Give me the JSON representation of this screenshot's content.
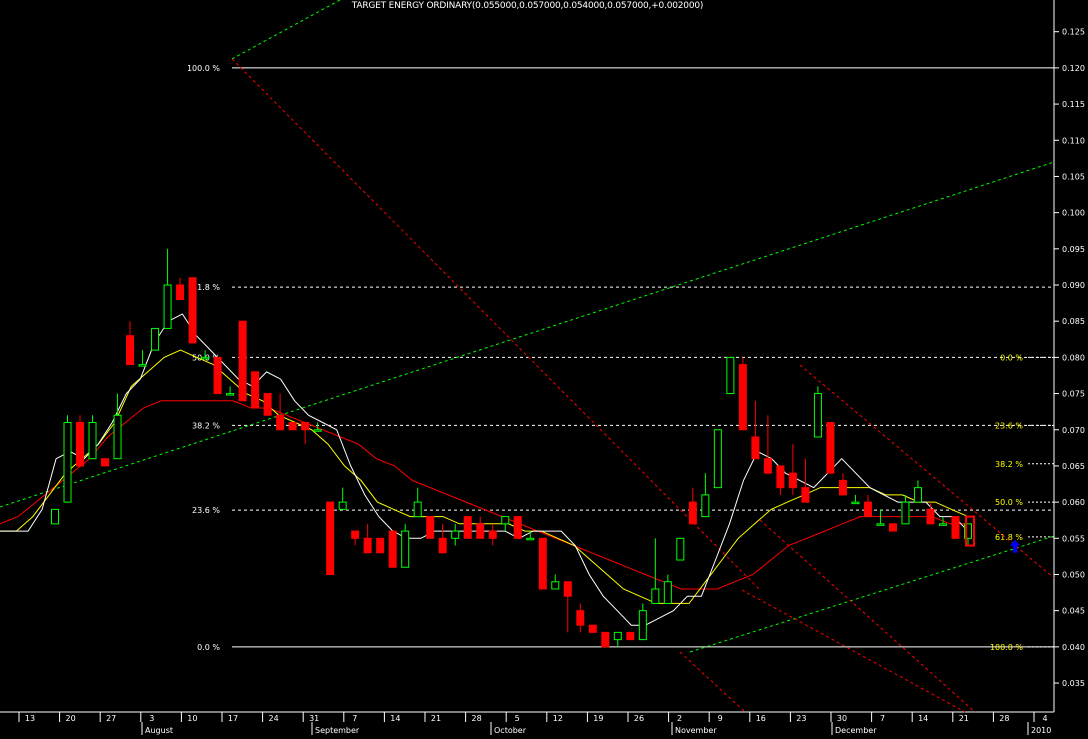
{
  "chart_data": {
    "type": "candlestick",
    "title": "TARGET ENERGY ORDINARY(0.055000,0.057000,0.054000,0.057000,+0.002000)",
    "colors": {
      "background": "#000000",
      "up_candle": "#00ff00",
      "down_candle": "#ff0000",
      "ma_fast": "#ffffff",
      "ma_mid": "#ffff00",
      "ma_slow": "#ff0000",
      "trendline": "#00ff00",
      "fan_line": "#ff0000",
      "fib_level": "#ffffff",
      "fib_label_right": "#ffff00",
      "arrow": "#0000ff"
    },
    "y_axis": {
      "range": [
        0.031,
        0.128
      ],
      "ticks": [
        "0.035",
        "0.040",
        "0.045",
        "0.050",
        "0.055",
        "0.060",
        "0.065",
        "0.070",
        "0.075",
        "0.080",
        "0.085",
        "0.090",
        "0.095",
        "0.100",
        "0.105",
        "0.110",
        "0.115",
        "0.120",
        "0.125"
      ]
    },
    "x_axis": {
      "day_ticks": [
        "13",
        "20",
        "27",
        "3",
        "10",
        "17",
        "24",
        "31",
        "7",
        "14",
        "21",
        "28",
        "5",
        "12",
        "19",
        "26",
        "2",
        "9",
        "16",
        "23",
        "30",
        "7",
        "14",
        "21",
        "28",
        "4"
      ],
      "months": [
        "August",
        "September",
        "October",
        "November",
        "December",
        "2010"
      ]
    },
    "fib_retracement_left": [
      {
        "label": "100.0 %",
        "value": 0.12
      },
      {
        "label": "61.8 %",
        "value": 0.0897
      },
      {
        "label": "50.0 %",
        "value": 0.08
      },
      {
        "label": "38.2 %",
        "value": 0.0706
      },
      {
        "label": "23.6 %",
        "value": 0.0589
      },
      {
        "label": "0.0 %",
        "value": 0.04
      }
    ],
    "fib_retracement_right": [
      {
        "label": "0.0 %",
        "value": 0.08
      },
      {
        "label": "23.6 %",
        "value": 0.0706
      },
      {
        "label": "38.2 %",
        "value": 0.0653
      },
      {
        "label": "50.0 %",
        "value": 0.06
      },
      {
        "label": "61.8 %",
        "value": 0.0552
      },
      {
        "label": "100.0 %",
        "value": 0.04
      }
    ],
    "candles": [
      [
        0.057,
        0.059,
        0.057,
        0.059
      ],
      [
        0.06,
        0.072,
        0.06,
        0.071
      ],
      [
        0.071,
        0.072,
        0.065,
        0.065
      ],
      [
        0.066,
        0.072,
        0.066,
        0.071
      ],
      [
        0.066,
        0.066,
        0.065,
        0.065
      ],
      [
        0.066,
        0.075,
        0.066,
        0.072
      ],
      [
        0.083,
        0.085,
        0.079,
        0.079
      ],
      [
        0.079,
        0.081,
        0.079,
        0.079
      ],
      [
        0.081,
        0.084,
        0.081,
        0.084
      ],
      [
        0.084,
        0.095,
        0.084,
        0.09
      ],
      [
        0.09,
        0.091,
        0.088,
        0.088
      ],
      [
        0.091,
        0.091,
        0.082,
        0.082
      ],
      [
        0.08,
        0.081,
        0.08,
        0.08
      ],
      [
        0.08,
        0.08,
        0.075,
        0.075
      ],
      [
        0.075,
        0.076,
        0.075,
        0.075
      ],
      [
        0.085,
        0.085,
        0.074,
        0.074
      ],
      [
        0.078,
        0.078,
        0.073,
        0.073
      ],
      [
        0.075,
        0.075,
        0.072,
        0.072
      ],
      [
        0.072,
        0.075,
        0.07,
        0.07
      ],
      [
        0.071,
        0.071,
        0.07,
        0.07
      ],
      [
        0.071,
        0.071,
        0.068,
        0.07
      ],
      [
        0.07,
        0.071,
        0.07,
        0.07
      ],
      [
        0.06,
        0.06,
        0.05,
        0.05
      ],
      [
        0.059,
        0.062,
        0.059,
        0.06
      ],
      [
        0.056,
        0.056,
        0.054,
        0.055
      ],
      [
        0.055,
        0.057,
        0.053,
        0.053
      ],
      [
        0.055,
        0.055,
        0.053,
        0.053
      ],
      [
        0.056,
        0.056,
        0.051,
        0.051
      ],
      [
        0.051,
        0.057,
        0.051,
        0.056
      ],
      [
        0.058,
        0.062,
        0.058,
        0.06
      ],
      [
        0.058,
        0.058,
        0.055,
        0.055
      ],
      [
        0.055,
        0.057,
        0.053,
        0.053
      ],
      [
        0.055,
        0.057,
        0.054,
        0.056
      ],
      [
        0.058,
        0.058,
        0.055,
        0.055
      ],
      [
        0.057,
        0.058,
        0.055,
        0.055
      ],
      [
        0.056,
        0.057,
        0.054,
        0.055
      ],
      [
        0.057,
        0.058,
        0.056,
        0.058
      ],
      [
        0.058,
        0.058,
        0.055,
        0.055
      ],
      [
        0.055,
        0.056,
        0.055,
        0.055
      ],
      [
        0.055,
        0.055,
        0.048,
        0.048
      ],
      [
        0.048,
        0.05,
        0.048,
        0.049
      ],
      [
        0.049,
        0.049,
        0.042,
        0.047
      ],
      [
        0.045,
        0.046,
        0.042,
        0.043
      ],
      [
        0.043,
        0.043,
        0.042,
        0.042
      ],
      [
        0.042,
        0.042,
        0.04,
        0.04
      ],
      [
        0.041,
        0.042,
        0.04,
        0.042
      ],
      [
        0.042,
        0.042,
        0.041,
        0.041
      ],
      [
        0.041,
        0.046,
        0.041,
        0.045
      ],
      [
        0.046,
        0.055,
        0.046,
        0.048
      ],
      [
        0.046,
        0.05,
        0.046,
        0.049
      ],
      [
        0.052,
        0.055,
        0.052,
        0.055
      ],
      [
        0.06,
        0.062,
        0.057,
        0.057
      ],
      [
        0.058,
        0.064,
        0.058,
        0.061
      ],
      [
        0.062,
        0.07,
        0.062,
        0.07
      ],
      [
        0.075,
        0.08,
        0.075,
        0.08
      ],
      [
        0.079,
        0.08,
        0.07,
        0.07
      ],
      [
        0.069,
        0.074,
        0.066,
        0.066
      ],
      [
        0.066,
        0.072,
        0.064,
        0.064
      ],
      [
        0.065,
        0.065,
        0.061,
        0.062
      ],
      [
        0.064,
        0.068,
        0.061,
        0.062
      ],
      [
        0.062,
        0.066,
        0.06,
        0.06
      ],
      [
        0.069,
        0.076,
        0.069,
        0.075
      ],
      [
        0.071,
        0.071,
        0.064,
        0.064
      ],
      [
        0.063,
        0.064,
        0.061,
        0.061
      ],
      [
        0.06,
        0.061,
        0.06,
        0.06
      ],
      [
        0.06,
        0.061,
        0.058,
        0.058
      ],
      [
        0.057,
        0.059,
        0.057,
        0.057
      ],
      [
        0.057,
        0.057,
        0.056,
        0.056
      ],
      [
        0.057,
        0.061,
        0.057,
        0.06
      ],
      [
        0.06,
        0.063,
        0.06,
        0.062
      ],
      [
        0.059,
        0.06,
        0.057,
        0.057
      ],
      [
        0.057,
        0.058,
        0.057,
        0.057
      ],
      [
        0.058,
        0.058,
        0.055,
        0.055
      ],
      [
        0.055,
        0.057,
        0.054,
        0.057
      ]
    ],
    "ma_fast": [
      0.056,
      0.056,
      0.056,
      0.059,
      0.066,
      0.067,
      0.066,
      0.068,
      0.071,
      0.075,
      0.077,
      0.082,
      0.085,
      0.086,
      0.083,
      0.081,
      0.079,
      0.077,
      0.076,
      0.078,
      0.077,
      0.074,
      0.072,
      0.071,
      0.07,
      0.065,
      0.061,
      0.058,
      0.056,
      0.055,
      0.055,
      0.056,
      0.056,
      0.056,
      0.056,
      0.056,
      0.056,
      0.055,
      0.056,
      0.056,
      0.056,
      0.054,
      0.05,
      0.047,
      0.045,
      0.043,
      0.043,
      0.044,
      0.045,
      0.047,
      0.047,
      0.052,
      0.057,
      0.063,
      0.067,
      0.066,
      0.064,
      0.063,
      0.062,
      0.064,
      0.066,
      0.064,
      0.062,
      0.061,
      0.06,
      0.06,
      0.06,
      0.058,
      0.058,
      0.056
    ],
    "ma_mid": [
      0.056,
      0.056,
      0.058,
      0.061,
      0.064,
      0.066,
      0.068,
      0.071,
      0.076,
      0.078,
      0.08,
      0.081,
      0.08,
      0.079,
      0.077,
      0.075,
      0.074,
      0.072,
      0.071,
      0.07,
      0.068,
      0.065,
      0.063,
      0.06,
      0.059,
      0.058,
      0.058,
      0.058,
      0.057,
      0.057,
      0.057,
      0.057,
      0.056,
      0.056,
      0.055,
      0.054,
      0.052,
      0.05,
      0.048,
      0.047,
      0.046,
      0.046,
      0.046,
      0.049,
      0.052,
      0.055,
      0.057,
      0.059,
      0.06,
      0.061,
      0.062,
      0.062,
      0.062,
      0.062,
      0.061,
      0.061,
      0.06,
      0.06,
      0.059,
      0.058
    ],
    "ma_slow": [
      0.057,
      0.058,
      0.06,
      0.062,
      0.064,
      0.066,
      0.069,
      0.071,
      0.073,
      0.074,
      0.074,
      0.074,
      0.074,
      0.074,
      0.073,
      0.073,
      0.072,
      0.071,
      0.07,
      0.069,
      0.068,
      0.066,
      0.065,
      0.063,
      0.062,
      0.061,
      0.06,
      0.059,
      0.058,
      0.057,
      0.056,
      0.055,
      0.054,
      0.053,
      0.052,
      0.051,
      0.05,
      0.049,
      0.048,
      0.048,
      0.048,
      0.049,
      0.05,
      0.052,
      0.054,
      0.055,
      0.056,
      0.057,
      0.058,
      0.058,
      0.058,
      0.058,
      0.058,
      0.057,
      0.057
    ]
  }
}
